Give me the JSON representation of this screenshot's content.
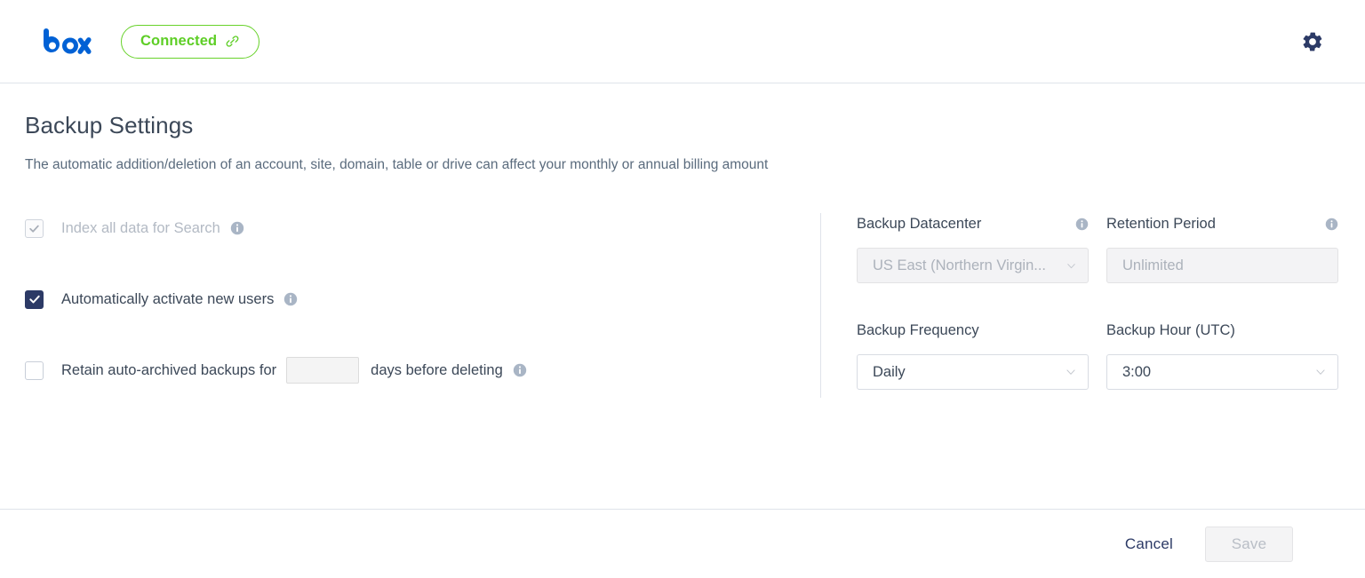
{
  "header": {
    "brand": "box",
    "brand_icon": "box-logo",
    "status_badge": {
      "label": "Connected",
      "icon": "link-icon",
      "color": "#5ece26"
    },
    "settings_icon": "gear-icon"
  },
  "main": {
    "title": "Backup Settings",
    "description": "The automatic addition/deletion of an account, site, domain, table or drive can affect your monthly or annual billing amount",
    "checkboxes": [
      {
        "label": "Index all data for Search",
        "checked": true,
        "disabled": true,
        "info_icon": "info-icon"
      },
      {
        "label": "Automatically activate new users",
        "checked": true,
        "disabled": false,
        "info_icon": "info-icon"
      },
      {
        "label": "Retain auto-archived backups for",
        "suffix": "days before deleting",
        "value": "",
        "placeholder": "",
        "checked": false,
        "disabled": false,
        "info_icon": "info-icon"
      }
    ],
    "fields": [
      {
        "label": "Backup Datacenter",
        "value": "US East (Northern Virgin...",
        "type": "select",
        "disabled": true,
        "has_info": true,
        "info_icon": "info-icon",
        "chevron_icon": "chevron-down-icon"
      },
      {
        "label": "Retention Period",
        "value": "Unlimited",
        "type": "text",
        "disabled": true,
        "has_info": true,
        "info_icon": "info-icon",
        "chevron_icon": ""
      },
      {
        "label": "Backup Frequency",
        "value": "Daily",
        "type": "select",
        "disabled": false,
        "has_info": false,
        "info_icon": "",
        "chevron_icon": "chevron-down-icon"
      },
      {
        "label": "Backup Hour (UTC)",
        "value": "3:00",
        "type": "select",
        "disabled": false,
        "has_info": false,
        "info_icon": "",
        "chevron_icon": "chevron-down-icon"
      }
    ]
  },
  "footer": {
    "cancel_label": "Cancel",
    "save_label": "Save",
    "save_disabled": true
  },
  "colors": {
    "brand_blue": "#0061d5",
    "accent_green": "#5ece26",
    "navy": "#2c3a66",
    "text": "#3c4858",
    "muted": "#b3bac4",
    "border": "#dfe3ea"
  }
}
